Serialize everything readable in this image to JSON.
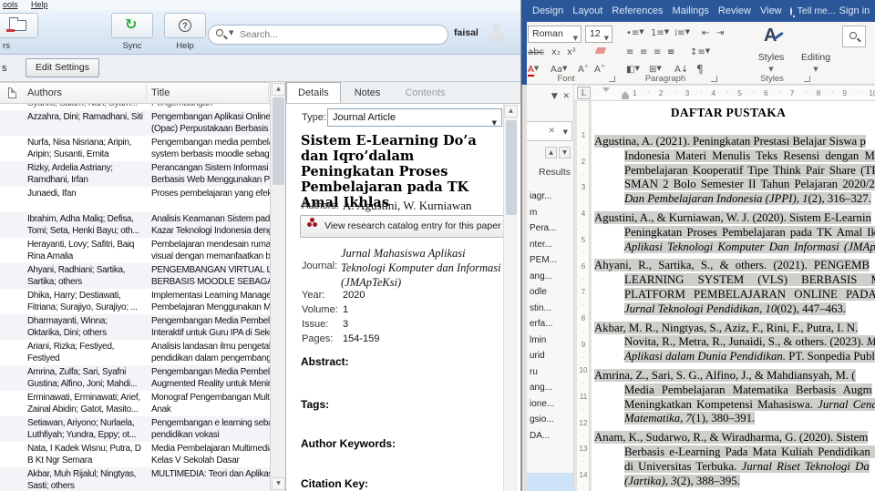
{
  "colors": {
    "word_blue": "#2b579a",
    "selection_grey": "#d0cecb",
    "sync_green": "#2fae3e",
    "mendeley_red": "#9d1620",
    "nav_selected_blue": "#cfe3f8",
    "toolbar_blue_top": "#ebf3fb"
  },
  "mendeley": {
    "menu": [
      "ools",
      "Help"
    ],
    "toolbar": {
      "folders_label": "rs",
      "sync_label": "Sync",
      "help_label": "Help",
      "search_placeholder": "Search...",
      "user": "faisal"
    },
    "settings_row": {
      "cut_label": "s",
      "edit_settings": "Edit Settings"
    },
    "table": {
      "col_authors": "Authors",
      "col_title": "Title"
    },
    "scroll": {
      "up": "▲",
      "down": "▼"
    },
    "partial_row": {
      "a": [
        "Syahru, Salam; Nan, Syam..."
      ],
      "t": [
        "Pengembangan"
      ]
    },
    "rows": [
      {
        "a": [
          "Azzahra, Dini; Ramadhani, Siti"
        ],
        "t": [
          "Pengembangan Aplikasi Online Pu",
          "(Opac) Perpustakaan Berbasis We"
        ]
      },
      {
        "a": [
          "Nurfa, Nisa Nisriana; Aripin,",
          "Aripin; Susanti, Ernita"
        ],
        "t": [
          "Pengembangan media pembelajar",
          "system berbasis moodle sebagai c"
        ]
      },
      {
        "a": [
          "Rizky, Ardelia Astriany;",
          "Ramdhani, Irfan"
        ],
        "t": [
          "Perancangan Sistem Informasi Pe",
          "Berbasis Web Menggunakan PHP"
        ]
      },
      {
        "a": [
          "Junaedi, Ifan"
        ],
        "t": [
          "Proses pembelajaran yang efektif"
        ]
      },
      {
        "a": [
          "Ibrahim, Adha Maliq; Defisa,",
          "Tomi; Seta, Henki Bayu; oth..."
        ],
        "t": [
          "Analisis Keamanan Sistem pada W",
          "Kazar Teknologi Indonesia dengan"
        ]
      },
      {
        "a": [
          "Herayanti, Lovy; Safitri, Baiq",
          "Rina Amalia"
        ],
        "t": [
          "Pembelajaran mendesain rumah m",
          "visual dengan memanfaatkan ban"
        ]
      },
      {
        "a": [
          "Ahyani, Radhiani; Sartika,",
          "Sartika; others"
        ],
        "t": [
          "PENGEMBANGAN VIRTUAL LEARN",
          "BERBASIS MOODLE SEBAGAI PLA"
        ]
      },
      {
        "a": [
          "Dhika, Harry; Destiawati,",
          "Fitriana; Surajiyo, Surajiyo; ..."
        ],
        "t": [
          "Implementasi Learning Manageme",
          "Pembelajaran Menggunakan Mood"
        ]
      },
      {
        "a": [
          "Dharmayanti, Winna;",
          "Oktarika, Dini; others"
        ],
        "t": [
          "Pengembangan Media Pembelajar",
          "Interaktif untuk Guru IPA di Sekol"
        ]
      },
      {
        "a": [
          "Ariani, Rizka; Festiyed,",
          "Festiyed"
        ],
        "t": [
          "Analisis landasan ilmu pengetahua",
          "pendidikan dalam pengembangan"
        ]
      },
      {
        "a": [
          "Amrina, Zulfa; Sari, Syafni",
          "Gustina; Alfino, Joni; Mahdi..."
        ],
        "t": [
          "Pengembangan Media Pembelajar",
          "Augmented Reality untuk Meningk"
        ]
      },
      {
        "a": [
          "Erminawati, Erminawati; Arief,",
          "Zainal Abidin; Gatot, Masito..."
        ],
        "t": [
          "Monograf Pengembangan Multime",
          "Anak"
        ]
      },
      {
        "a": [
          "Setiawan, Ariyono; Nurlaela,",
          "Luthfiyah; Yundra, Eppy; ot..."
        ],
        "t": [
          "Pengembangan e learning sebaga",
          "pendidikan vokasi"
        ]
      },
      {
        "a": [
          "Nata, I Kadek Wisnu; Putra, D",
          "B Kt Ngr Semara"
        ],
        "t": [
          "Media Pembelajaran Multimedia In",
          "Kelas V Sekolah Dasar"
        ]
      },
      {
        "a": [
          "Akbar, Muh Rijalul; Ningtyas,",
          "Sasti; others"
        ],
        "t": [
          "MULTIMEDIA: Teori dan Aplikasi d",
          ""
        ]
      }
    ],
    "details": {
      "tabs": [
        "Details",
        "Notes",
        "Contents"
      ],
      "type_label": "Type:",
      "type_value": "Journal Article",
      "title": "Sistem E-Learning Do’a dan Iqro’dalam Peningkatan Proses Pembelajaran pada TK Amal Ikhlas",
      "authors_label": "Authors:",
      "authors_value": "A. Agustini, W. Kurniawan",
      "catalog_button": "View research catalog entry for this paper",
      "journal_label": "Journal:",
      "journal_value": "Jurnal Mahasiswa Aplikasi Teknologi Komputer dan Informasi (JMApTeKsi)",
      "fields": [
        {
          "label": "Year:",
          "value": "2020"
        },
        {
          "label": "Volume:",
          "value": "1"
        },
        {
          "label": "Issue:",
          "value": "3"
        },
        {
          "label": "Pages:",
          "value": "154-159"
        }
      ],
      "sections": [
        "Abstract:",
        "Tags:",
        "Author Keywords:",
        "Citation Key:"
      ]
    }
  },
  "word": {
    "tabs": [
      "Design",
      "Layout",
      "References",
      "Mailings",
      "Review",
      "View"
    ],
    "tellme": "Tell me...",
    "signin": "Sign in",
    "ribbon": {
      "font_name": "Roman",
      "font_size": "12",
      "styles_label": "Styles",
      "editing_label": "Editing",
      "group_labels": [
        "Font",
        "Paragraph",
        "Styles"
      ]
    },
    "nav_pane": {
      "results_label": "Results",
      "items": [
        "iagr...",
        "m",
        "Pera...",
        "nter...",
        "PEM...",
        "ang...",
        "odle",
        "stin...",
        "erfa...",
        "lmin",
        "urid",
        "ru",
        "ang...",
        "ione...",
        "gsio...",
        "DA..."
      ]
    },
    "ruler_h": [
      "1",
      "2",
      "3",
      "4",
      "5",
      "6",
      "7",
      "8",
      "9",
      "10"
    ],
    "ruler_v": [
      "1",
      "2",
      "3",
      "4",
      "5",
      "6",
      "7",
      "8",
      "9",
      "10",
      "11",
      "12",
      "13",
      "14"
    ],
    "tab_selector": "L",
    "document": {
      "heading": "DAFTAR PUSTAKA",
      "references": [
        {
          "lines": [
            {
              "s": [
                [
                  "Agustina, A. (2021). Peningkatan Prestasi Belajar Siswa p",
                  0
                ]
              ]
            },
            {
              "s": [
                [
                  "Indonesia Materi Menulis Teks Resensi dengan M",
                  0
                ]
              ],
              "ws": 3
            },
            {
              "s": [
                [
                  "Pembelajaran Kooperatif Tipe Think Pair Share (TPS)",
                  0
                ]
              ],
              "ws": 2
            },
            {
              "s": [
                [
                  "SMAN 2 Bolo Semester II Tahun Pelajaran 2020/202",
                  0
                ]
              ],
              "ws": 2
            },
            {
              "s": [
                [
                  "Dan Pembelajaran Indonesia (JPPI)",
                  1
                ],
                [
                  ", ",
                  0
                ],
                [
                  "1",
                  1
                ],
                [
                  "(2), 316–327.",
                  0
                ]
              ]
            }
          ]
        },
        {
          "lines": [
            {
              "s": [
                [
                  "Agustini, A., & Kurniawan, W. J. (2020). Sistem E-Learnin",
                  0
                ]
              ]
            },
            {
              "s": [
                [
                  "Peningkatan Proses Pembelajaran pada TK Amal Ikhl",
                  0
                ]
              ],
              "ws": 2
            },
            {
              "s": [
                [
                  "Aplikasi Teknologi Komputer Dan Informasi (JMApTe",
                  1
                ]
              ],
              "ws": 2
            }
          ]
        },
        {
          "lines": [
            {
              "s": [
                [
                  "Ahyani, R., Sartika, S., & others. (2021). PENGEMB",
                  0
                ]
              ],
              "ws": 4
            },
            {
              "s": [
                [
                  "LEARNING SYSTEM (VLS) BERBASIS M",
                  0
                ]
              ],
              "ws": 12
            },
            {
              "s": [
                [
                  "PLATFORM PEMBELAJARAN ONLINE PADA CO",
                  0
                ]
              ],
              "ws": 6
            },
            {
              "s": [
                [
                  "Jurnal Teknologi Pendidikan, 10",
                  1
                ],
                [
                  "(02), 447–463.",
                  0
                ]
              ]
            }
          ]
        },
        {
          "lines": [
            {
              "s": [
                [
                  "Akbar, M. R., Ningtyas, S., Aziz, F., Rini, F., Putra, I. N.",
                  0
                ]
              ]
            },
            {
              "s": [
                [
                  "Novita, R., Metra, R., Junaidi, S., & others. (2023). ",
                  0
                ],
                [
                  "MU",
                  1
                ]
              ]
            },
            {
              "s": [
                [
                  "Aplikasi dalam Dunia Pendidikan.",
                  1
                ],
                [
                  " PT. Sonpedia Publis",
                  0
                ]
              ]
            }
          ]
        },
        {
          "lines": [
            {
              "s": [
                [
                  "Amrina, Z., Sari, S. G., Alfino, J., & Mahdiansyah, M. (",
                  0
                ]
              ]
            },
            {
              "s": [
                [
                  "Media Pembelajaran Matematika Berbasis Augm",
                  0
                ]
              ],
              "ws": 5
            },
            {
              "s": [
                [
                  "Meningkatkan Kompetensi Mahasiswa. ",
                  0
                ],
                [
                  "Jurnal Cendek",
                  1
                ]
              ],
              "ws": 2
            },
            {
              "s": [
                [
                  "Matematika, 7",
                  1
                ],
                [
                  "(1), 380–391.",
                  0
                ]
              ]
            }
          ]
        },
        {
          "lines": [
            {
              "s": [
                [
                  "Anam, K., Sudarwo, R., & Wiradharma, G. (2020). Sistem ",
                  0
                ]
              ]
            },
            {
              "s": [
                [
                  "Berbasis e-Learning Pada Mata Kuliah Pendidikan Mat",
                  0
                ]
              ],
              "ws": 2
            },
            {
              "s": [
                [
                  "di Universitas Terbuka. ",
                  0
                ],
                [
                  "Jurnal Riset Teknologi Da",
                  1
                ]
              ],
              "ws": 2
            },
            {
              "s": [
                [
                  "(Jartika), 3",
                  1
                ],
                [
                  "(2), 388–395.",
                  0
                ]
              ]
            }
          ]
        }
      ]
    }
  }
}
